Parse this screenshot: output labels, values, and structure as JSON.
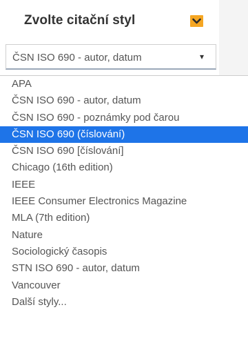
{
  "panel": {
    "title": "Zvolte citační styl",
    "toggle_icon": "chevron-down-icon",
    "toggle_color": "#f5a623"
  },
  "select": {
    "current_value": "ČSN ISO 690 - autor, datum",
    "caret": "▾"
  },
  "dropdown": {
    "highlight_color": "#1e74e8",
    "options": [
      {
        "label": "APA"
      },
      {
        "label": "ČSN ISO 690 - autor, datum"
      },
      {
        "label": "ČSN ISO 690 - poznámky pod čarou"
      },
      {
        "label": "ČSN ISO 690 (číslování)",
        "highlighted": true
      },
      {
        "label": "ČSN ISO 690 [číslování]"
      },
      {
        "label": "Chicago (16th edition)"
      },
      {
        "label": "IEEE"
      },
      {
        "label": "IEEE Consumer Electronics Magazine"
      },
      {
        "label": "MLA (7th edition)"
      },
      {
        "label": "Nature"
      },
      {
        "label": "Sociologický časopis"
      },
      {
        "label": "STN ISO 690 - autor, datum"
      },
      {
        "label": "Vancouver"
      },
      {
        "label": "Další styly..."
      }
    ]
  }
}
